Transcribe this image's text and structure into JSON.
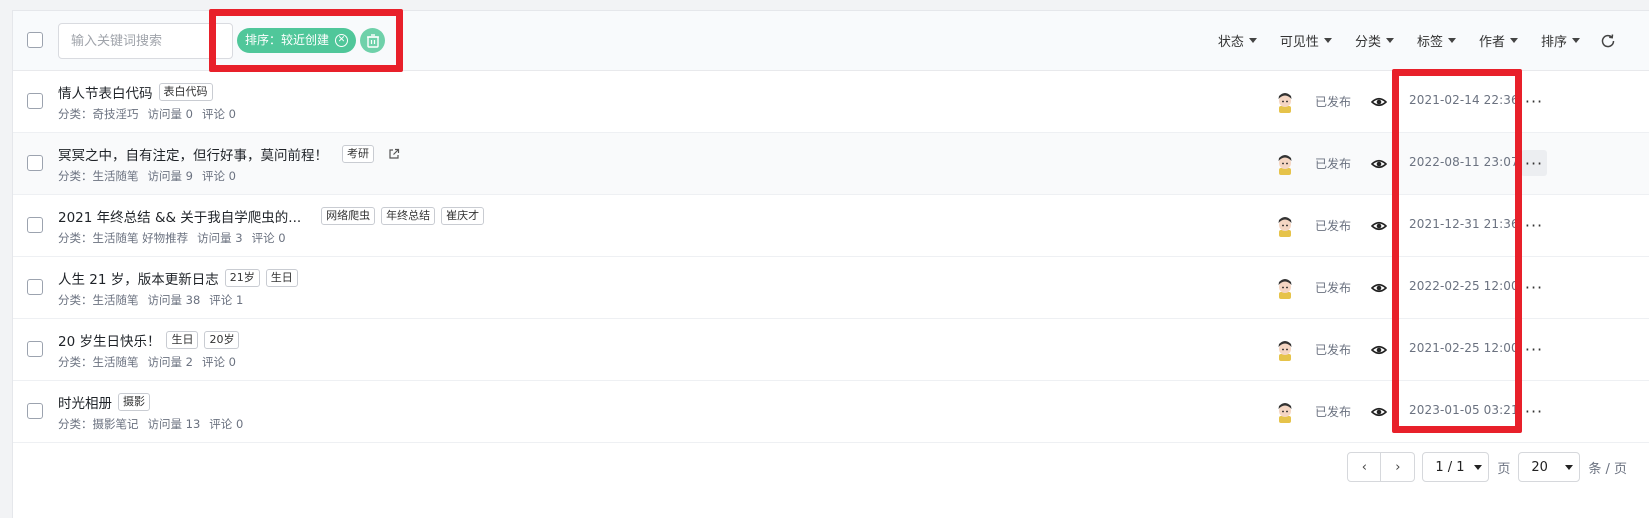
{
  "toolbar": {
    "search_placeholder": "输入关键词搜索",
    "sort_chip": "排序：较近创建",
    "filters": [
      "状态",
      "可见性",
      "分类",
      "标签",
      "作者",
      "排序"
    ]
  },
  "posts": [
    {
      "title": "情人节表白代码",
      "tags": [
        "表白代码"
      ],
      "category_label": "分类：",
      "category": "奇技淫巧",
      "views": "访问量 0",
      "comments": "评论 0",
      "status": "已发布",
      "date": "2021-02-14 22:36",
      "external": false
    },
    {
      "title": "冥冥之中，自有注定，但行好事，莫问前程！",
      "tags": [
        "考研"
      ],
      "category_label": "分类：",
      "category": "生活随笔",
      "views": "访问量 9",
      "comments": "评论 0",
      "status": "已发布",
      "date": "2022-08-11 23:07",
      "external": true
    },
    {
      "title": "2021 年终总结 && 关于我自学爬虫的...",
      "tags": [
        "网络爬虫",
        "年终总结",
        "崔庆才"
      ],
      "category_label": "分类：",
      "category": "生活随笔 好物推荐",
      "views": "访问量 3",
      "comments": "评论 0",
      "status": "已发布",
      "date": "2021-12-31 21:36",
      "external": false
    },
    {
      "title": "人生 21 岁，版本更新日志",
      "tags": [
        "21岁",
        "生日"
      ],
      "category_label": "分类：",
      "category": "生活随笔",
      "views": "访问量 38",
      "comments": "评论 1",
      "status": "已发布",
      "date": "2022-02-25 12:00",
      "external": false
    },
    {
      "title": "20 岁生日快乐！",
      "tags": [
        "生日",
        "20岁"
      ],
      "category_label": "分类：",
      "category": "生活随笔",
      "views": "访问量 2",
      "comments": "评论 0",
      "status": "已发布",
      "date": "2021-02-25 12:00",
      "external": false
    },
    {
      "title": "时光相册",
      "tags": [
        "摄影"
      ],
      "category_label": "分类：",
      "category": "摄影笔记",
      "views": "访问量 13",
      "comments": "评论 0",
      "status": "已发布",
      "date": "2023-01-05 03:21",
      "external": false
    }
  ],
  "pagination": {
    "page": "1 / 1",
    "page_label": "页",
    "page_size": "20",
    "size_label": "条 / 页"
  },
  "colors": {
    "chip": "#50c79a",
    "highlight": "#e8202a"
  }
}
